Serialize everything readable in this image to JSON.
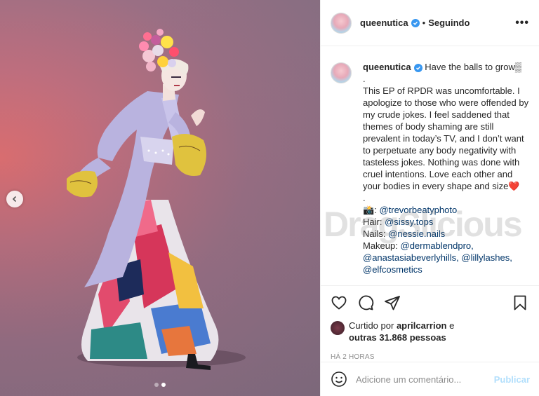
{
  "post": {
    "username": "queenutica",
    "follow_state": "Seguindo",
    "more_label": "•••"
  },
  "caption": {
    "username": "queenutica",
    "lines": [
      "Have the balls to grow▒",
      ".",
      "This EP of RPDR was uncomfortable. I apologize to those who were offended by my crude jokes. I feel saddened that themes of body shaming are still prevalent in today’s TV, and I don’t want to perpetuate any body negativity with tasteless jokes. Nothing was done with cruel intentions. Love each other and your bodies in every shape and size",
      "❤️",
      "."
    ],
    "credits": {
      "photo_emoji": "📸:",
      "photo": "@trevorbeatyphoto",
      "hair_label": "Hair:",
      "hair": "@sissy.tops",
      "nails_label": "Nails:",
      "nails": "@nessie.nails",
      "makeup_label": "Makeup:",
      "makeup1": "@dermablendpro,",
      "makeup2": "@anastasiabeverlyhills,",
      "makeup3": "@lillylashes,",
      "makeup4": "@elfcosmetics"
    }
  },
  "watermark": "DragSlicious",
  "likes": {
    "prefix": "Curtido por",
    "user": "aprilcarrion",
    "suffix": "e",
    "others": "outras 31.868 pessoas"
  },
  "timestamp": "HÁ 2 HORAS",
  "comment": {
    "placeholder": "Adicione um comentário...",
    "publish_label": "Publicar"
  },
  "carousel": {
    "dots": 2,
    "active_index": 1
  },
  "icons": {
    "like": "heart-icon",
    "comment": "comment-icon",
    "share": "paper-plane-icon",
    "save": "bookmark-icon",
    "emoji": "smiley-icon",
    "prev": "chevron-left-icon",
    "verified": "verified-badge-icon",
    "more": "ellipsis-icon"
  },
  "colors": {
    "link": "#003569",
    "verified": "#3897f0",
    "publish_disabled": "#b2dffc",
    "timestamp": "#8e8e8e"
  }
}
